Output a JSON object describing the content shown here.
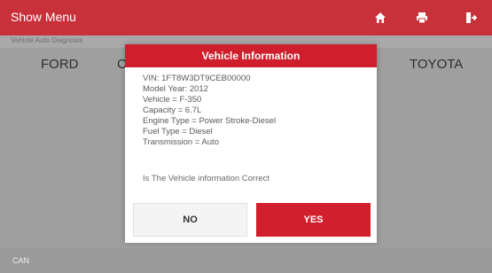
{
  "app": {
    "title": "Show Menu",
    "breadcrumb": "Vehicle Auto Diagnosis",
    "colors": {
      "accent": "#c8303a",
      "button_primary": "#d21f2d"
    },
    "toolbar_icons": [
      "home-icon",
      "printer-icon",
      "exit-icon"
    ]
  },
  "brands": {
    "left": "FORD",
    "left_partial": "C",
    "right": "TOYOTA"
  },
  "status": {
    "info": "CAN"
  },
  "dialog": {
    "title": "Vehicle Information",
    "lines": {
      "vin": "VIN:  1FT8W3DT9CEB00000",
      "model_year": "Model Year:  2012",
      "vehicle": "Vehicle = F-350",
      "capacity": "Capacity = 6.7L",
      "engine_type": "Engine Type = Power Stroke-Diesel",
      "fuel_type": "Fuel Type = Diesel",
      "transmission": "Transmission = Auto"
    },
    "question": "Is The Vehicle information Correct",
    "buttons": {
      "no": "NO",
      "yes": "YES"
    }
  }
}
